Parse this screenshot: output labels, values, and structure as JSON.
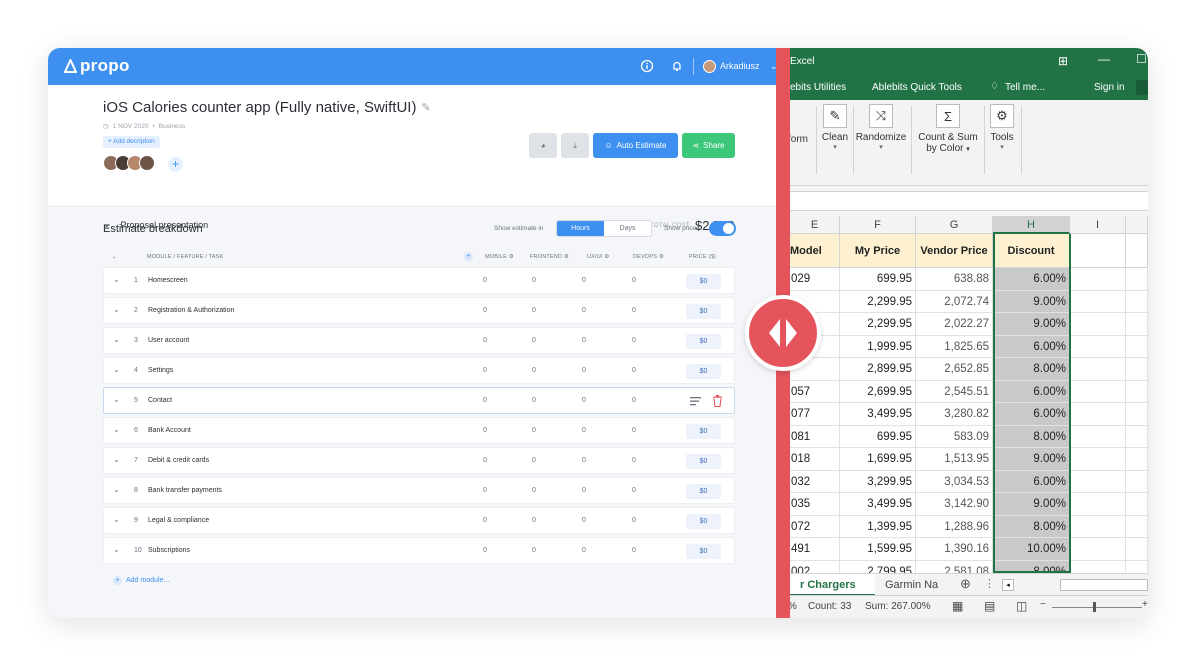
{
  "propo": {
    "brand": "propo",
    "user": "Arkadiusz",
    "title": "iOS Calories counter app (Fully native, SwiftUI)",
    "date": "1 NOV 2020",
    "dot": "•",
    "category": "Business",
    "add_description": "+ Add decription",
    "auto_estimate": "Auto Estimate",
    "share": "Share",
    "proposal": "Proposal presentation",
    "total_label": "TOTAL COST",
    "total_value": "$2.550",
    "estimate_title": "Estimate breakdown",
    "show_estimate": "Show estimate in",
    "seg_hours": "Hours",
    "seg_days": "Days",
    "show_prices": "Show prices",
    "col_module": "MODULE / FEATURE / TASK",
    "col_mobile": "MOBILE ⚙",
    "col_frontend": "FRONTEND ⚙",
    "col_uxui": "UX/UI ⚙",
    "col_devops": "DEVOPS ⚙",
    "col_price": "PRICE ($)",
    "add_module": "Add module...",
    "rows": [
      {
        "num": "1",
        "name": "Homescreen",
        "m": "0",
        "f": "0",
        "u": "0",
        "d": "0",
        "price": "$0"
      },
      {
        "num": "2",
        "name": "Registration & Authorization",
        "m": "0",
        "f": "0",
        "u": "0",
        "d": "0",
        "price": "$0"
      },
      {
        "num": "3",
        "name": "User account",
        "m": "0",
        "f": "0",
        "u": "0",
        "d": "0",
        "price": "$0"
      },
      {
        "num": "4",
        "name": "Settings",
        "m": "0",
        "f": "0",
        "u": "0",
        "d": "0",
        "price": "$0"
      },
      {
        "num": "5",
        "name": "Contact",
        "m": "0",
        "f": "0",
        "u": "0",
        "d": "0",
        "price": ""
      },
      {
        "num": "6",
        "name": "Bank Account",
        "m": "0",
        "f": "0",
        "u": "0",
        "d": "0",
        "price": "$0"
      },
      {
        "num": "7",
        "name": "Debit & credit cards",
        "m": "0",
        "f": "0",
        "u": "0",
        "d": "0",
        "price": "$0"
      },
      {
        "num": "8",
        "name": "Bank transfer payments",
        "m": "0",
        "f": "0",
        "u": "0",
        "d": "0",
        "price": "$0"
      },
      {
        "num": "9",
        "name": "Legal & compliance",
        "m": "0",
        "f": "0",
        "u": "0",
        "d": "0",
        "price": "$0"
      },
      {
        "num": "10",
        "name": "Subscriptions",
        "m": "0",
        "f": "0",
        "u": "0",
        "d": "0",
        "price": "$0"
      }
    ]
  },
  "excel": {
    "title": "Excel",
    "tab1": "ebits Utilities",
    "tab2": "Ablebits Quick Tools",
    "tell_me": "Tell me...",
    "sign_in": "Sign in",
    "ribbon": {
      "form": "form",
      "clean": "Clean",
      "randomize": "Randomize",
      "count_sum_1": "Count & Sum",
      "count_sum_2": "by Color",
      "tools": "Tools"
    },
    "col_letters": [
      "E",
      "F",
      "G",
      "H",
      "I"
    ],
    "headers": {
      "model": "Model",
      "my_price": "My Price",
      "vendor_price": "Vendor Price",
      "discount": "Discount"
    },
    "rows": [
      {
        "model": "029",
        "my": "699.95",
        "vendor": "638.88",
        "disc": "6.00%"
      },
      {
        "model": "",
        "my": "2,299.95",
        "vendor": "2,072.74",
        "disc": "9.00%"
      },
      {
        "model": "",
        "my": "2,299.95",
        "vendor": "2,022.27",
        "disc": "9.00%"
      },
      {
        "model": "",
        "my": "1,999.95",
        "vendor": "1,825.65",
        "disc": "6.00%"
      },
      {
        "model": "",
        "my": "2,899.95",
        "vendor": "2,652.85",
        "disc": "8.00%"
      },
      {
        "model": "057",
        "my": "2,699.95",
        "vendor": "2,545.51",
        "disc": "6.00%"
      },
      {
        "model": "077",
        "my": "3,499.95",
        "vendor": "3,280.82",
        "disc": "6.00%"
      },
      {
        "model": "081",
        "my": "699.95",
        "vendor": "583.09",
        "disc": "8.00%"
      },
      {
        "model": "018",
        "my": "1,699.95",
        "vendor": "1,513.95",
        "disc": "9.00%"
      },
      {
        "model": "032",
        "my": "3,299.95",
        "vendor": "3,034.53",
        "disc": "6.00%"
      },
      {
        "model": "035",
        "my": "3,499.95",
        "vendor": "3,142.90",
        "disc": "9.00%"
      },
      {
        "model": "072",
        "my": "1,399.95",
        "vendor": "1,288.96",
        "disc": "8.00%"
      },
      {
        "model": "491",
        "my": "1,599.95",
        "vendor": "1,390.16",
        "disc": "10.00%"
      },
      {
        "model": "002",
        "my": "2,799.95",
        "vendor": "2,581.08",
        "disc": "8.00%"
      }
    ],
    "sheet_active": "r Chargers",
    "sheet_other": "Garmin Na",
    "status_count": "Count: 33",
    "status_sum": "Sum: 267.00%"
  }
}
